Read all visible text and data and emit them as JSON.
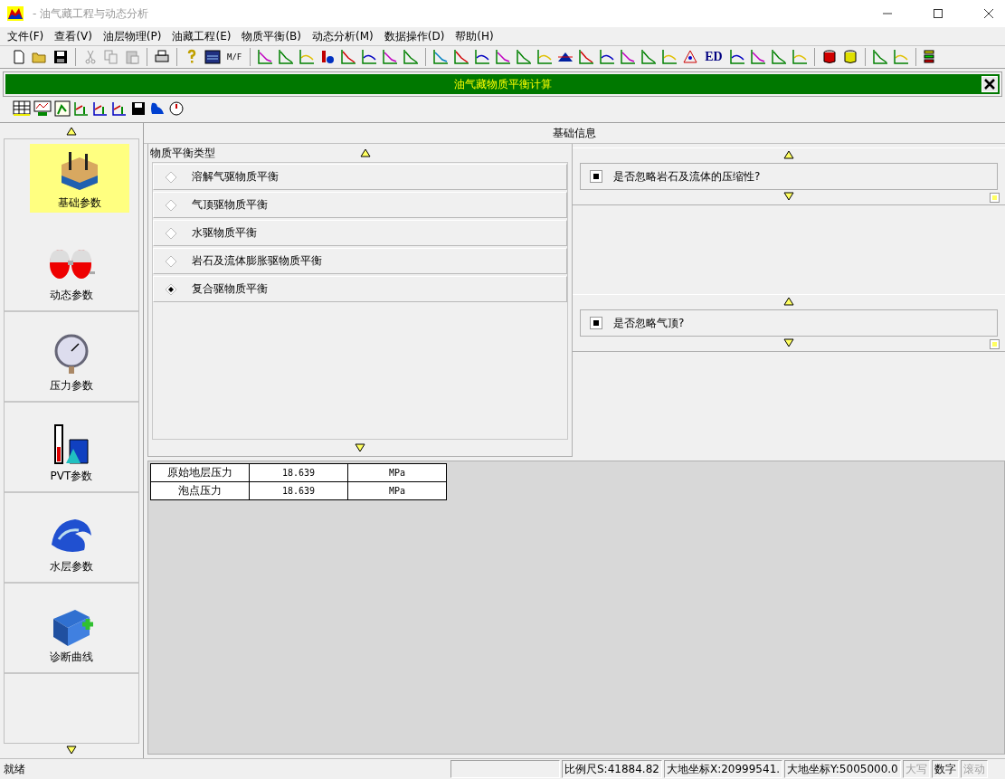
{
  "window": {
    "title": "- 油气藏工程与动态分析"
  },
  "menu": [
    {
      "label": "文件(F)"
    },
    {
      "label": "查看(V)"
    },
    {
      "label": "油层物理(P)"
    },
    {
      "label": "油藏工程(E)"
    },
    {
      "label": "物质平衡(B)"
    },
    {
      "label": "动态分析(M)"
    },
    {
      "label": "数据操作(D)"
    },
    {
      "label": "帮助(H)"
    }
  ],
  "toolbar": {
    "text_buttons": [
      "M/F",
      "ED"
    ]
  },
  "panel": {
    "title": "油气藏物质平衡计算"
  },
  "nav": {
    "items": [
      {
        "label": "基础参数",
        "selected": true
      },
      {
        "label": "动态参数",
        "selected": false
      },
      {
        "label": "压力参数",
        "selected": false
      },
      {
        "label": "PVT参数",
        "selected": false
      },
      {
        "label": "水层参数",
        "selected": false
      },
      {
        "label": "诊断曲线",
        "selected": false
      }
    ]
  },
  "section_title": "基础信息",
  "balance_type": {
    "title": "物质平衡类型",
    "options": [
      {
        "label": "溶解气驱物质平衡",
        "selected": false
      },
      {
        "label": "气顶驱物质平衡",
        "selected": false
      },
      {
        "label": "水驱物质平衡",
        "selected": false
      },
      {
        "label": "岩石及流体膨胀驱物质平衡",
        "selected": false
      },
      {
        "label": "复合驱物质平衡",
        "selected": true
      }
    ]
  },
  "options": [
    {
      "label": "是否忽略岩石及流体的压缩性?",
      "checked": true
    },
    {
      "label": "是否忽略气顶?",
      "checked": true
    }
  ],
  "parameters": [
    {
      "name": "原始地层压力",
      "value": "18.639",
      "unit": "MPa"
    },
    {
      "name": "泡点压力",
      "value": "18.639",
      "unit": "MPa"
    }
  ],
  "status_bar": {
    "message": "就绪",
    "scale": "比例尺S:41884.82",
    "x": "大地坐标X:20999541.",
    "y": "大地坐标Y:5005000.0",
    "indicators": [
      {
        "label": "大写",
        "on": false
      },
      {
        "label": "数字",
        "on": true
      },
      {
        "label": "滚动",
        "on": false
      }
    ]
  }
}
